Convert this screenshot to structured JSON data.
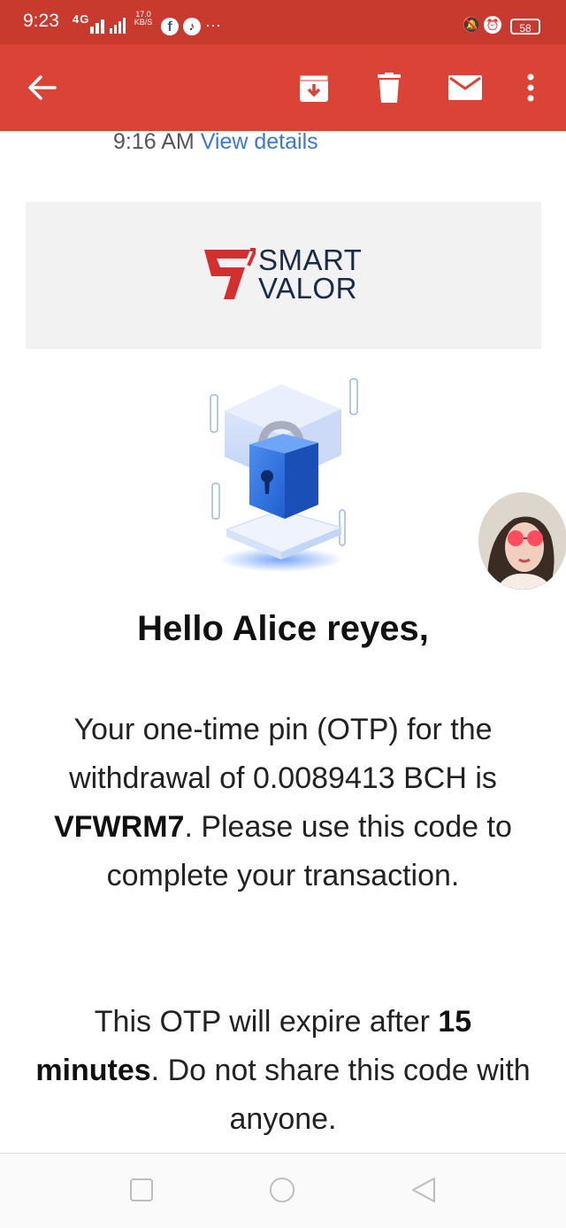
{
  "status_bar": {
    "time": "9:23",
    "network": "4G",
    "speed_value": "17.0",
    "speed_unit": "KB/S",
    "more": "···",
    "battery": "58"
  },
  "toolbar": {
    "back_icon": "arrow-left-icon",
    "archive_icon": "archive-icon",
    "delete_icon": "trash-icon",
    "mark_unread_icon": "mail-icon",
    "more_icon": "more-vert-icon"
  },
  "email_meta": {
    "time": "9:16 AM",
    "view_details": "View details"
  },
  "brand": {
    "line1": "SMART",
    "line2": "VALOR",
    "mark_color": "#d32f2f"
  },
  "greeting": "Hello Alice reyes,",
  "message": {
    "p1_a": "Your one-time pin (OTP) for the withdrawal of 0.0089413 BCH is ",
    "otp_code": "VFWRM7",
    "p1_b": ". Please use this code to complete your transaction.",
    "p2_a": "This OTP will expire after ",
    "expiry": "15 minutes",
    "p2_b": ". Do not share this code with anyone."
  },
  "colors": {
    "status_bar": "#c8392e",
    "toolbar": "#dc4337",
    "link": "#3a78d8"
  }
}
